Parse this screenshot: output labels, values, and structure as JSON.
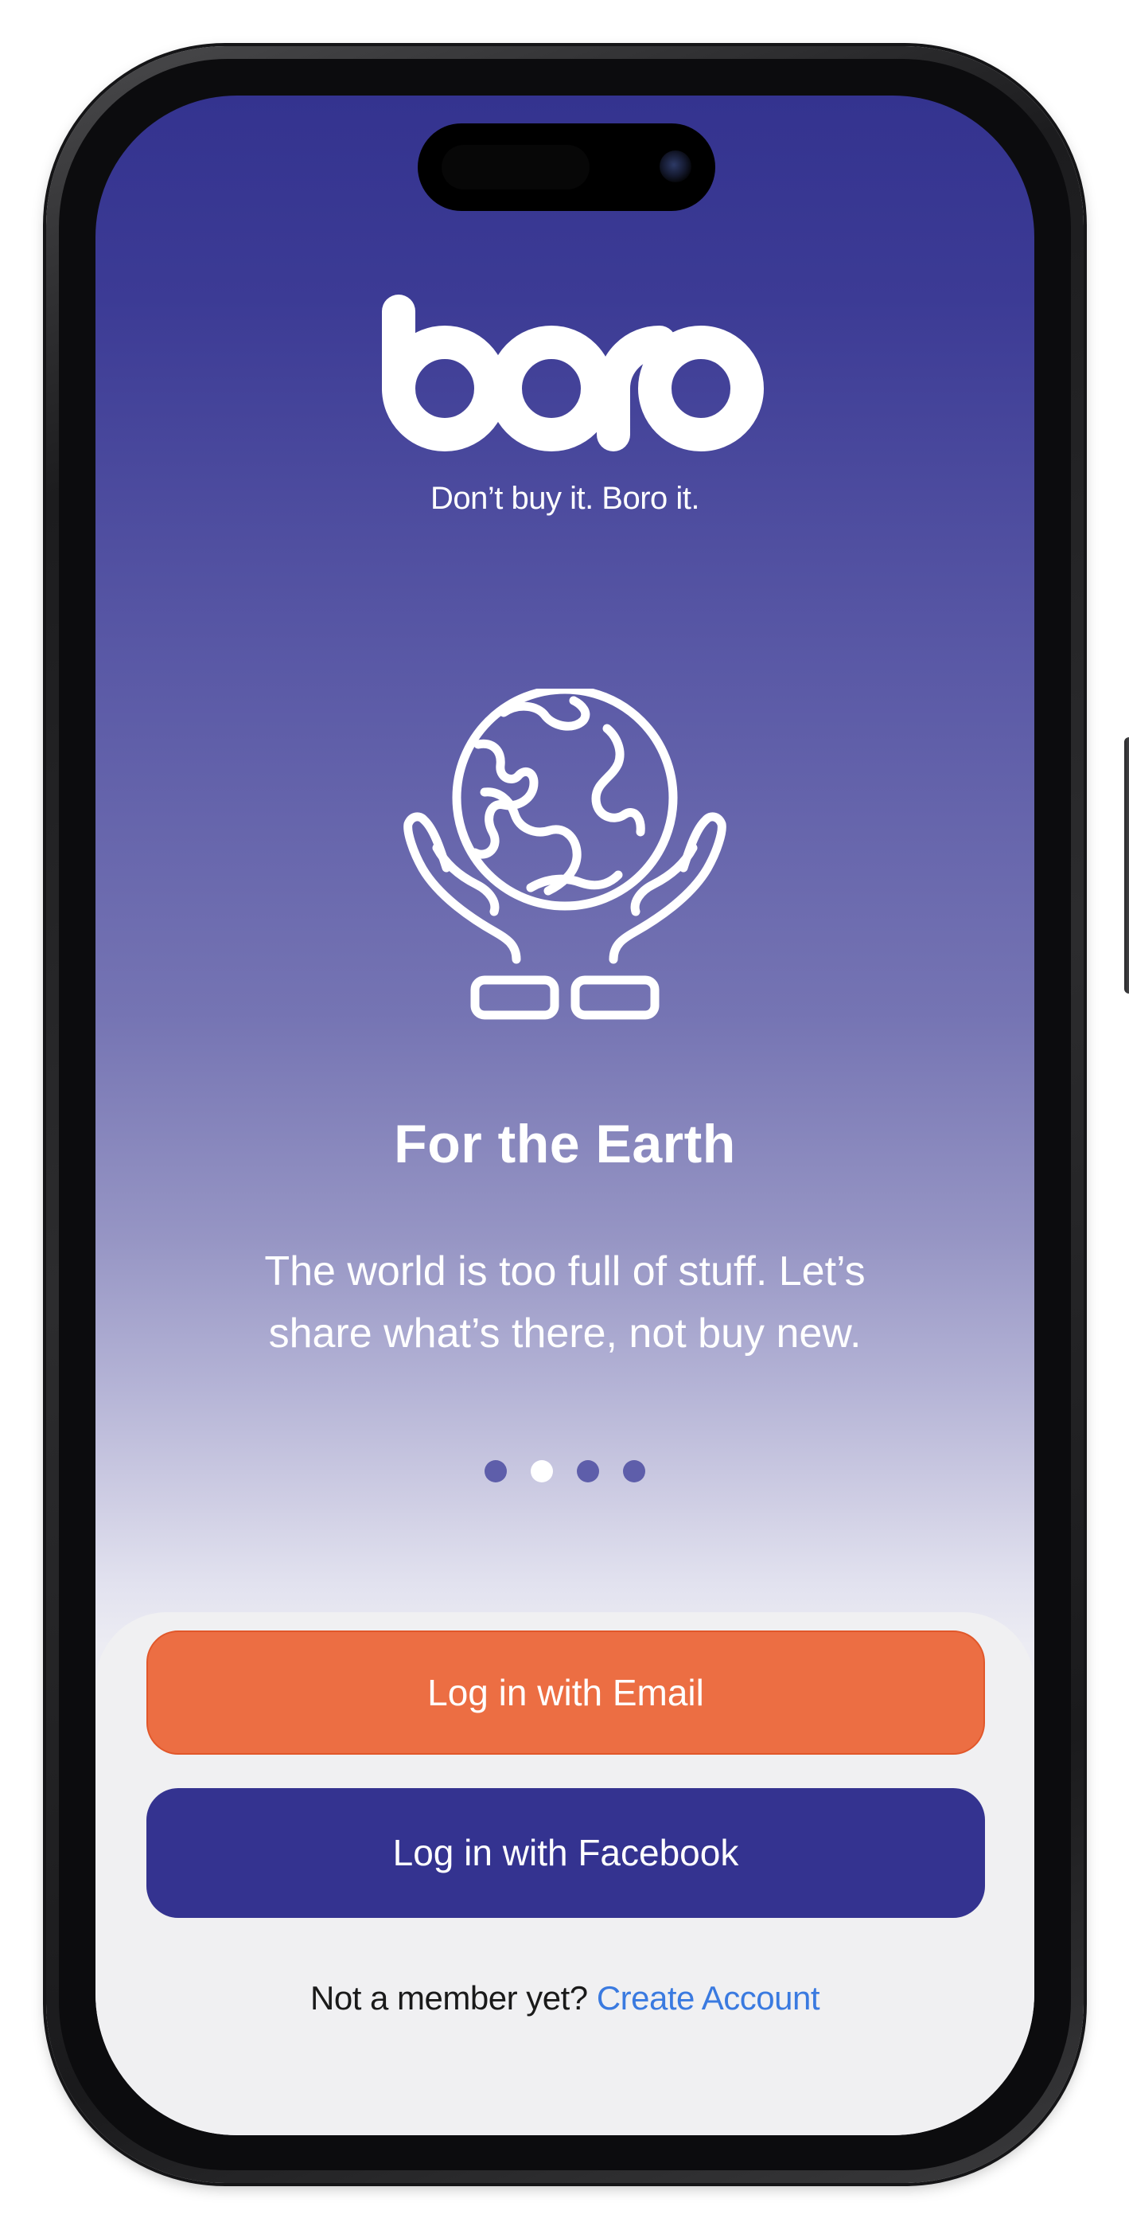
{
  "brand": {
    "name": "boro",
    "tagline": "Don’t buy it. Boro it."
  },
  "slide": {
    "icon": "hands-holding-globe-icon",
    "title": "For the Earth",
    "description": "The world is too full of stuff. Let’s share what’s there, not buy new."
  },
  "pager": {
    "count": 4,
    "active_index": 1
  },
  "actions": {
    "email_label": "Log in with Email",
    "facebook_label": "Log in with Facebook"
  },
  "signup": {
    "prompt": "Not a member yet?",
    "link_label": "Create Account"
  },
  "colors": {
    "brand_indigo": "#343390",
    "accent_orange": "#ec6e43",
    "link_blue": "#3a7ae0",
    "dot_inactive": "#5e5eaa",
    "dot_active": "#ffffff"
  }
}
